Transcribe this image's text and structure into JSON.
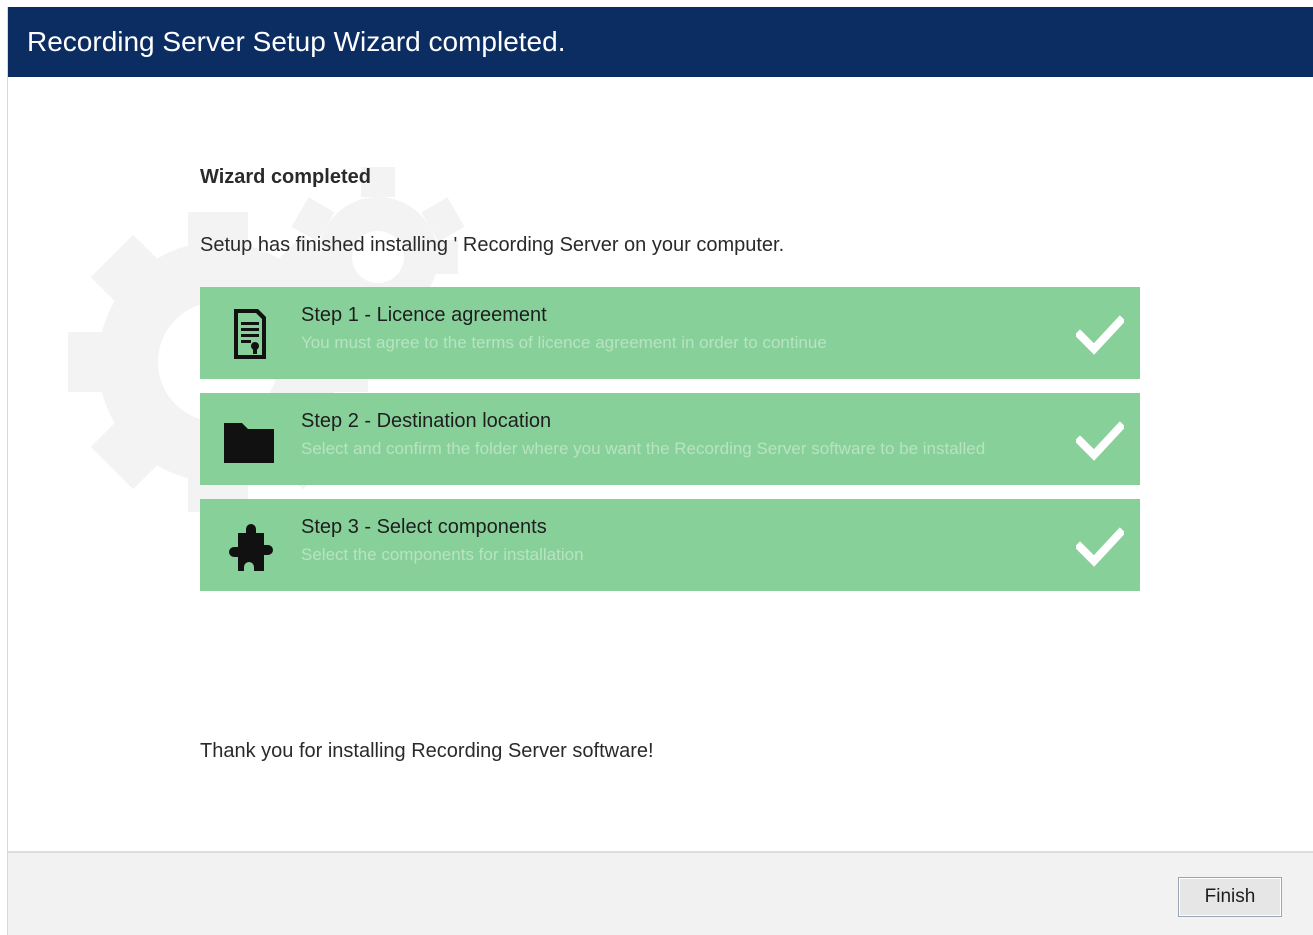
{
  "window": {
    "title": "Recording Server Setup Wizard completed."
  },
  "main": {
    "heading": "Wizard completed",
    "intro": "Setup has finished installing ' Recording Server on your computer.",
    "thanks": "Thank you for installing Recording Server software!"
  },
  "steps": [
    {
      "title": "Step 1 - Licence agreement",
      "subtitle": "You must agree to the terms of licence agreement in order to continue",
      "icon": "certificate-icon",
      "status": "completed"
    },
    {
      "title": "Step 2 - Destination location",
      "subtitle": "Select and confirm the folder where you want the Recording Server software to be installed",
      "icon": "folder-icon",
      "status": "completed"
    },
    {
      "title": "Step 3 - Select components",
      "subtitle": "Select the components for installation",
      "icon": "puzzle-icon",
      "status": "completed"
    }
  ],
  "footer": {
    "finish_label": "Finish"
  },
  "colors": {
    "titlebar": "#0b2d62",
    "step_background": "#88d09a",
    "step_subtitle": "#b7e3c1",
    "check": "#ffffff"
  }
}
